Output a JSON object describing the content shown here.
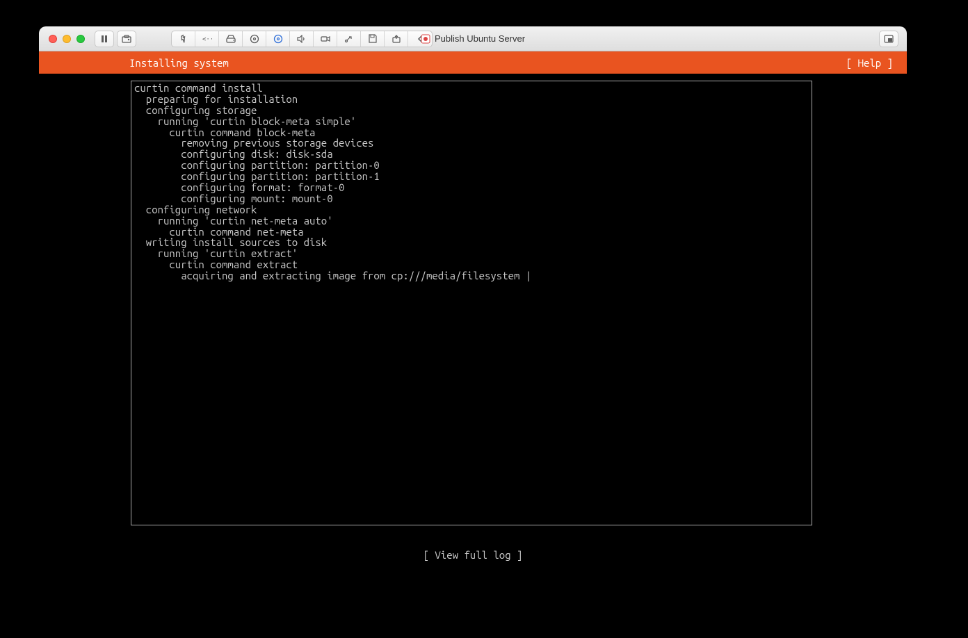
{
  "window": {
    "title": "Publish Ubuntu Server"
  },
  "installer": {
    "header_title": "Installing system",
    "help_label": "[ Help ]",
    "view_full_log_label": "[ View full log ]",
    "log_lines": [
      {
        "indent": 0,
        "text": "curtin command install"
      },
      {
        "indent": 1,
        "text": "preparing for installation"
      },
      {
        "indent": 1,
        "text": "configuring storage"
      },
      {
        "indent": 2,
        "text": "running 'curtin block-meta simple'"
      },
      {
        "indent": 3,
        "text": "curtin command block-meta"
      },
      {
        "indent": 4,
        "text": "removing previous storage devices"
      },
      {
        "indent": 4,
        "text": "configuring disk: disk-sda"
      },
      {
        "indent": 4,
        "text": "configuring partition: partition-0"
      },
      {
        "indent": 4,
        "text": "configuring partition: partition-1"
      },
      {
        "indent": 4,
        "text": "configuring format: format-0"
      },
      {
        "indent": 4,
        "text": "configuring mount: mount-0"
      },
      {
        "indent": 1,
        "text": "configuring network"
      },
      {
        "indent": 2,
        "text": "running 'curtin net-meta auto'"
      },
      {
        "indent": 3,
        "text": "curtin command net-meta"
      },
      {
        "indent": 1,
        "text": "writing install sources to disk"
      },
      {
        "indent": 2,
        "text": "running 'curtin extract'"
      },
      {
        "indent": 3,
        "text": "curtin command extract"
      },
      {
        "indent": 4,
        "text": "acquiring and extracting image from cp:///media/filesystem |"
      }
    ]
  }
}
